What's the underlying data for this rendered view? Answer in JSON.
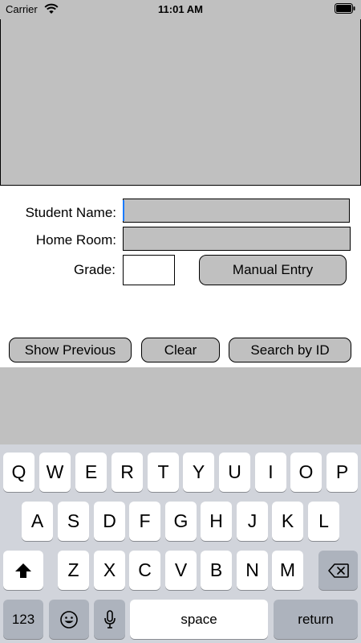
{
  "status_bar": {
    "carrier": "Carrier",
    "time": "11:01 AM"
  },
  "form": {
    "student_name_label": "Student Name:",
    "home_room_label": "Home Room:",
    "grade_label": "Grade:",
    "student_name_value": "",
    "home_room_value": "",
    "grade_value": "",
    "manual_entry_label": "Manual Entry"
  },
  "actions": {
    "show_previous_label": "Show Previous",
    "clear_label": "Clear",
    "search_by_id_label": "Search by ID"
  },
  "keyboard": {
    "row1": [
      "Q",
      "W",
      "E",
      "R",
      "T",
      "Y",
      "U",
      "I",
      "O",
      "P"
    ],
    "row2": [
      "A",
      "S",
      "D",
      "F",
      "G",
      "H",
      "J",
      "K",
      "L"
    ],
    "row3": [
      "Z",
      "X",
      "C",
      "V",
      "B",
      "N",
      "M"
    ],
    "numbers_label": "123",
    "space_label": "space",
    "return_label": "return"
  },
  "colors": {
    "panel_gray": "#c0c0c0",
    "keyboard_bg": "#d1d4db",
    "caret": "#1a7bff"
  }
}
